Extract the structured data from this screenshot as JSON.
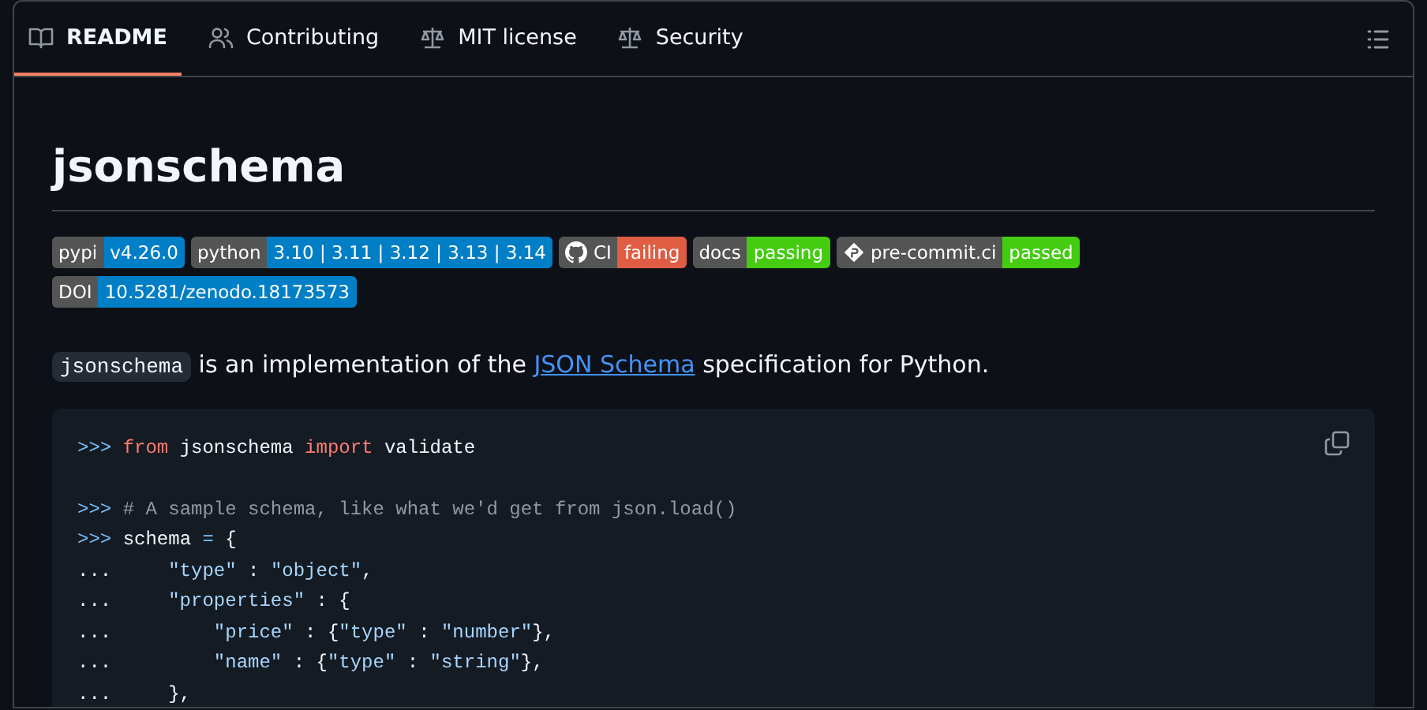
{
  "tabs": [
    {
      "label": "README",
      "kind": "book",
      "selected": true
    },
    {
      "label": "Contributing",
      "kind": "people",
      "selected": false
    },
    {
      "label": "MIT license",
      "kind": "scale",
      "selected": false
    },
    {
      "label": "Security",
      "kind": "scale",
      "selected": false
    }
  ],
  "title": "jsonschema",
  "badge_rows": [
    [
      {
        "label": "pypi",
        "value": "v4.26.0",
        "color": "#007ec6"
      },
      {
        "label": "python",
        "value": "3.10 | 3.11 | 3.12 | 3.13 | 3.14",
        "color": "#007ec6"
      },
      {
        "label": "CI",
        "value": "failing",
        "color": "#e05d44",
        "kind": "github"
      },
      {
        "label": "docs",
        "value": "passing",
        "color": "#4c1"
      },
      {
        "label": "pre-commit.ci",
        "value": "passed",
        "color": "#4c1",
        "kind": "diamond"
      }
    ],
    [
      {
        "label": "DOI",
        "value": "10.5281/zenodo.18173573",
        "color": "#007ec6"
      }
    ]
  ],
  "intro": [
    {
      "kind": "code",
      "text": "jsonschema"
    },
    {
      "kind": "text",
      "text": " is an implementation of the "
    },
    {
      "kind": "link",
      "text": "JSON Schema"
    },
    {
      "kind": "text",
      "text": " specification for Python."
    }
  ],
  "code_lines": [
    {
      "kind": "code",
      "tokens": [
        {
          "kind": "prompt",
          "text": ">>> "
        },
        {
          "kind": "keyword",
          "text": "from"
        },
        {
          "kind": "plain",
          "text": " jsonschema "
        },
        {
          "kind": "keyword",
          "text": "import"
        },
        {
          "kind": "plain",
          "text": " validate"
        }
      ]
    },
    {
      "kind": "blank"
    },
    {
      "kind": "code",
      "tokens": [
        {
          "kind": "prompt",
          "text": ">>> "
        },
        {
          "kind": "comment",
          "text": "# A sample schema, like what we'd get from json.load()"
        }
      ]
    },
    {
      "kind": "code",
      "tokens": [
        {
          "kind": "prompt",
          "text": ">>> "
        },
        {
          "kind": "plain",
          "text": "schema "
        },
        {
          "kind": "operator",
          "text": "="
        },
        {
          "kind": "plain",
          "text": " {"
        }
      ]
    },
    {
      "kind": "code",
      "tokens": [
        {
          "kind": "plain",
          "text": "...     "
        },
        {
          "kind": "string",
          "text": "\"type\""
        },
        {
          "kind": "plain",
          "text": " : "
        },
        {
          "kind": "string",
          "text": "\"object\""
        },
        {
          "kind": "plain",
          "text": ","
        }
      ]
    },
    {
      "kind": "code",
      "tokens": [
        {
          "kind": "plain",
          "text": "...     "
        },
        {
          "kind": "string",
          "text": "\"properties\""
        },
        {
          "kind": "plain",
          "text": " : {"
        }
      ]
    },
    {
      "kind": "code",
      "tokens": [
        {
          "kind": "plain",
          "text": "...         "
        },
        {
          "kind": "string",
          "text": "\"price\""
        },
        {
          "kind": "plain",
          "text": " : {"
        },
        {
          "kind": "string",
          "text": "\"type\""
        },
        {
          "kind": "plain",
          "text": " : "
        },
        {
          "kind": "string",
          "text": "\"number\""
        },
        {
          "kind": "plain",
          "text": "},"
        }
      ]
    },
    {
      "kind": "code",
      "tokens": [
        {
          "kind": "plain",
          "text": "...         "
        },
        {
          "kind": "string",
          "text": "\"name\""
        },
        {
          "kind": "plain",
          "text": " : {"
        },
        {
          "kind": "string",
          "text": "\"type\""
        },
        {
          "kind": "plain",
          "text": " : "
        },
        {
          "kind": "string",
          "text": "\"string\""
        },
        {
          "kind": "plain",
          "text": "},"
        }
      ]
    },
    {
      "kind": "code",
      "tokens": [
        {
          "kind": "plain",
          "text": "...     },"
        }
      ]
    }
  ]
}
